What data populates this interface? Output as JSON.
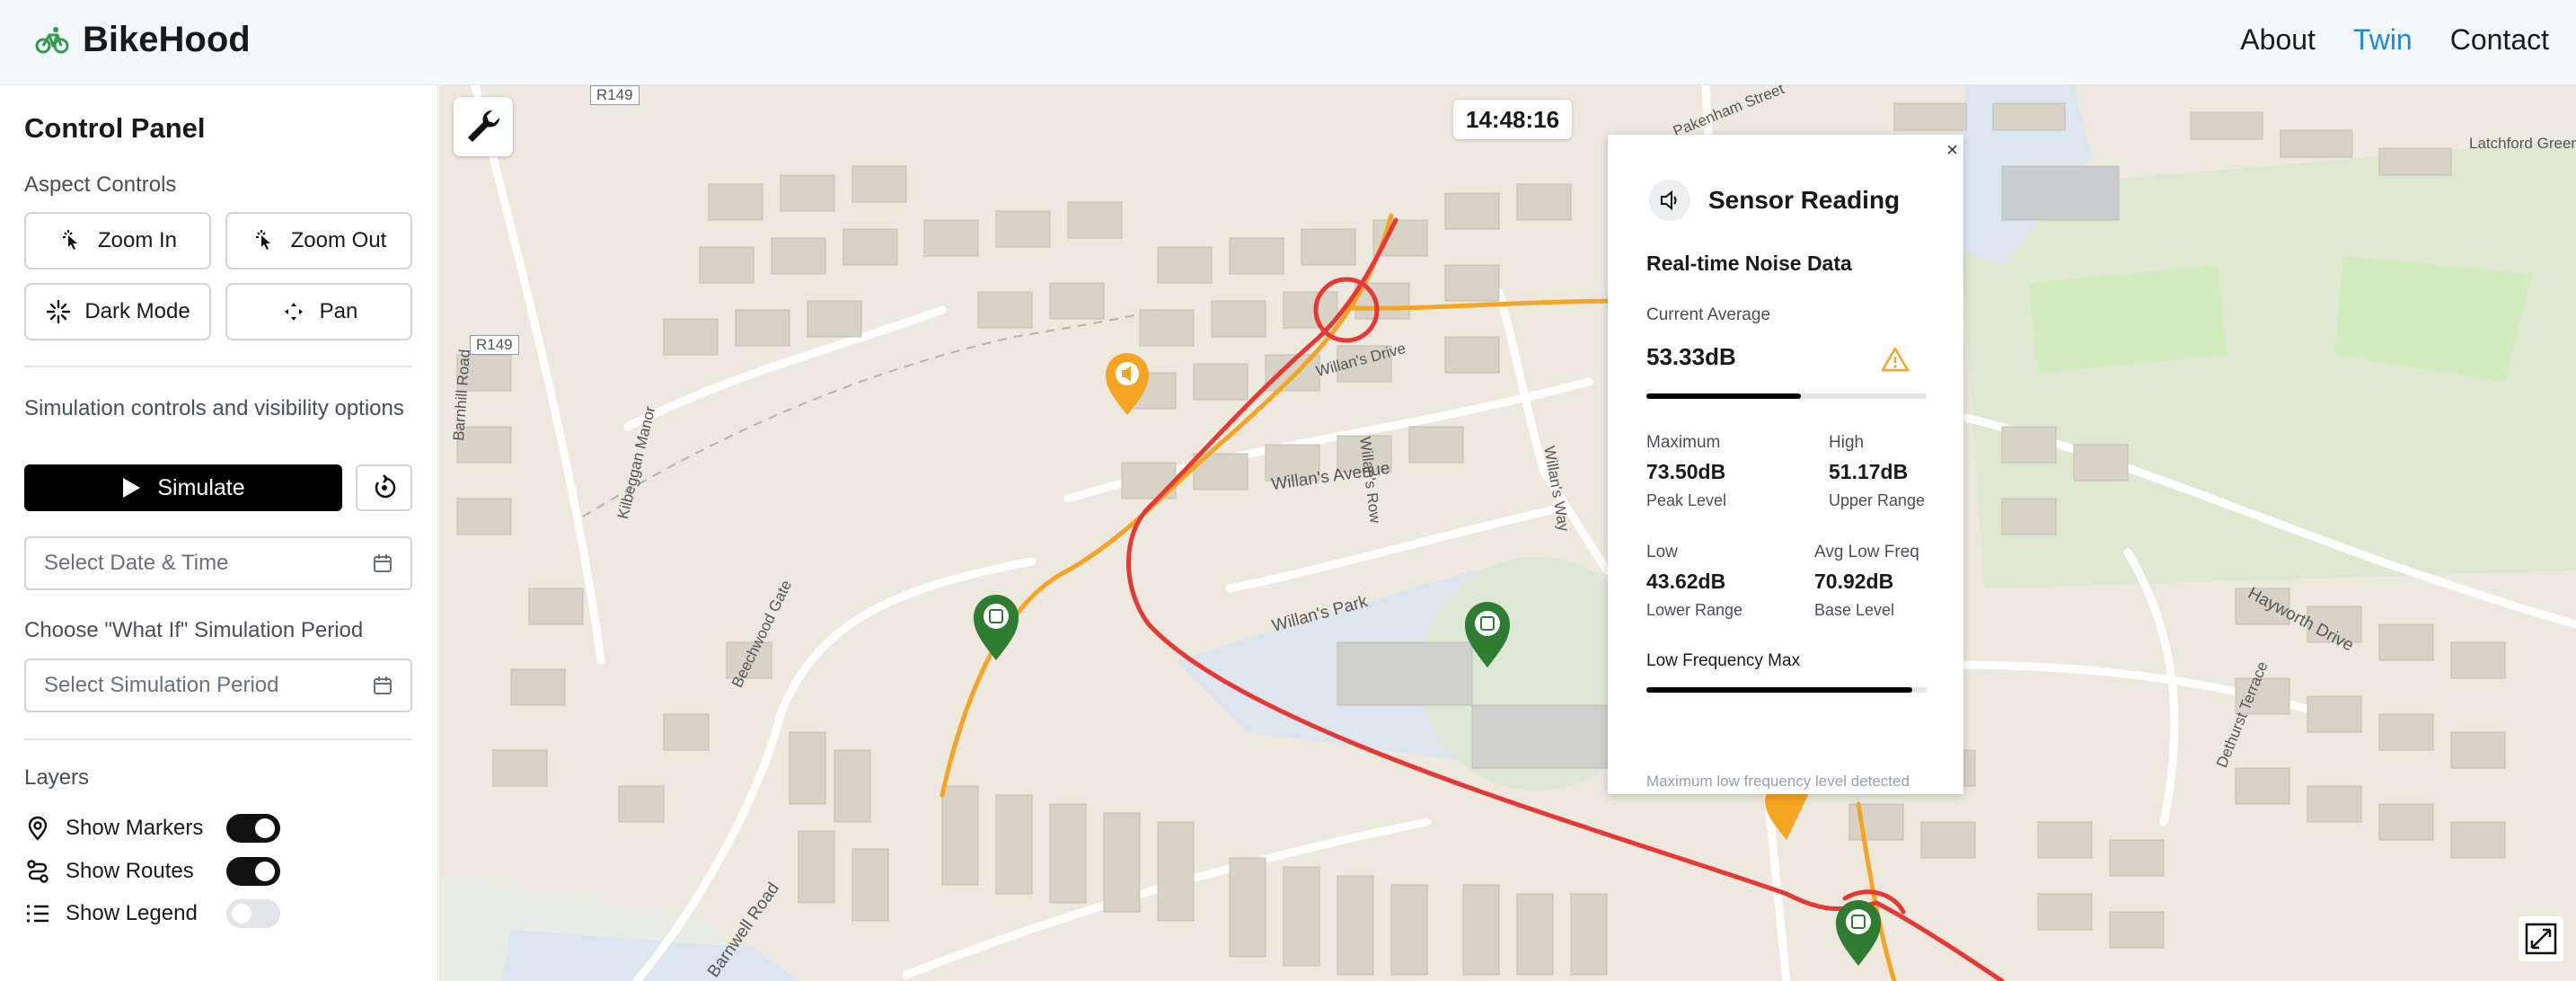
{
  "header": {
    "brand": "BikeHood",
    "nav": [
      {
        "label": "About",
        "active": false
      },
      {
        "label": "Twin",
        "active": true
      },
      {
        "label": "Contact",
        "active": false
      }
    ],
    "accent_color": "#1e88e5"
  },
  "sidebar": {
    "title": "Control Panel",
    "aspect_title": "Aspect Controls",
    "aspect_buttons": [
      {
        "label": "Zoom In",
        "icon": "pointer-click-icon"
      },
      {
        "label": "Zoom Out",
        "icon": "pointer-click-icon"
      },
      {
        "label": "Dark Mode",
        "icon": "sparkle-icon"
      },
      {
        "label": "Pan",
        "icon": "move-icon"
      }
    ],
    "sim_title": "Simulation controls and visibility options",
    "simulate_label": "Simulate",
    "date_placeholder": "Select Date & Time",
    "whatif_title": "Choose \"What If\" Simulation Period",
    "period_placeholder": "Select Simulation Period",
    "layers_title": "Layers",
    "layers": [
      {
        "label": "Show Markers",
        "icon": "pin-icon",
        "on": true
      },
      {
        "label": "Show Routes",
        "icon": "route-icon",
        "on": true
      },
      {
        "label": "Show Legend",
        "icon": "list-icon",
        "on": false
      }
    ]
  },
  "map": {
    "clock": "14:48:16",
    "labels": [
      "R149",
      "R149",
      "Barnhill Road",
      "Kilbeggan Manor",
      "Willan's Drive",
      "Willan's Row",
      "Willan's Avenue",
      "Willan's Way",
      "Willan's Park",
      "Barnwell Road",
      "Beechwood Gate",
      "Hayworth Drive",
      "Dethurst Terrace",
      "Latchford Green",
      "Pakenham Street"
    ],
    "route_colors": {
      "high": "#e53935",
      "medium": "#f5a524"
    }
  },
  "popup": {
    "close": "×",
    "title": "Sensor Reading",
    "subtitle": "Real-time Noise Data",
    "current_label": "Current Average",
    "current_value": "53.33dB",
    "current_fraction": 0.55,
    "max_label": "Maximum",
    "max_value": "73.50dB",
    "max_sub": "Peak Level",
    "high_label": "High",
    "high_value": "51.17dB",
    "high_sub": "Upper Range",
    "low_label": "Low",
    "low_value": "43.62dB",
    "low_sub": "Lower Range",
    "avglf_label": "Avg Low Freq",
    "avglf_value": "70.92dB",
    "avglf_sub": "Base Level",
    "lfmax_label": "Low Frequency Max",
    "lfmax_fraction": 0.95,
    "footer": "Maximum low frequency level detected"
  }
}
